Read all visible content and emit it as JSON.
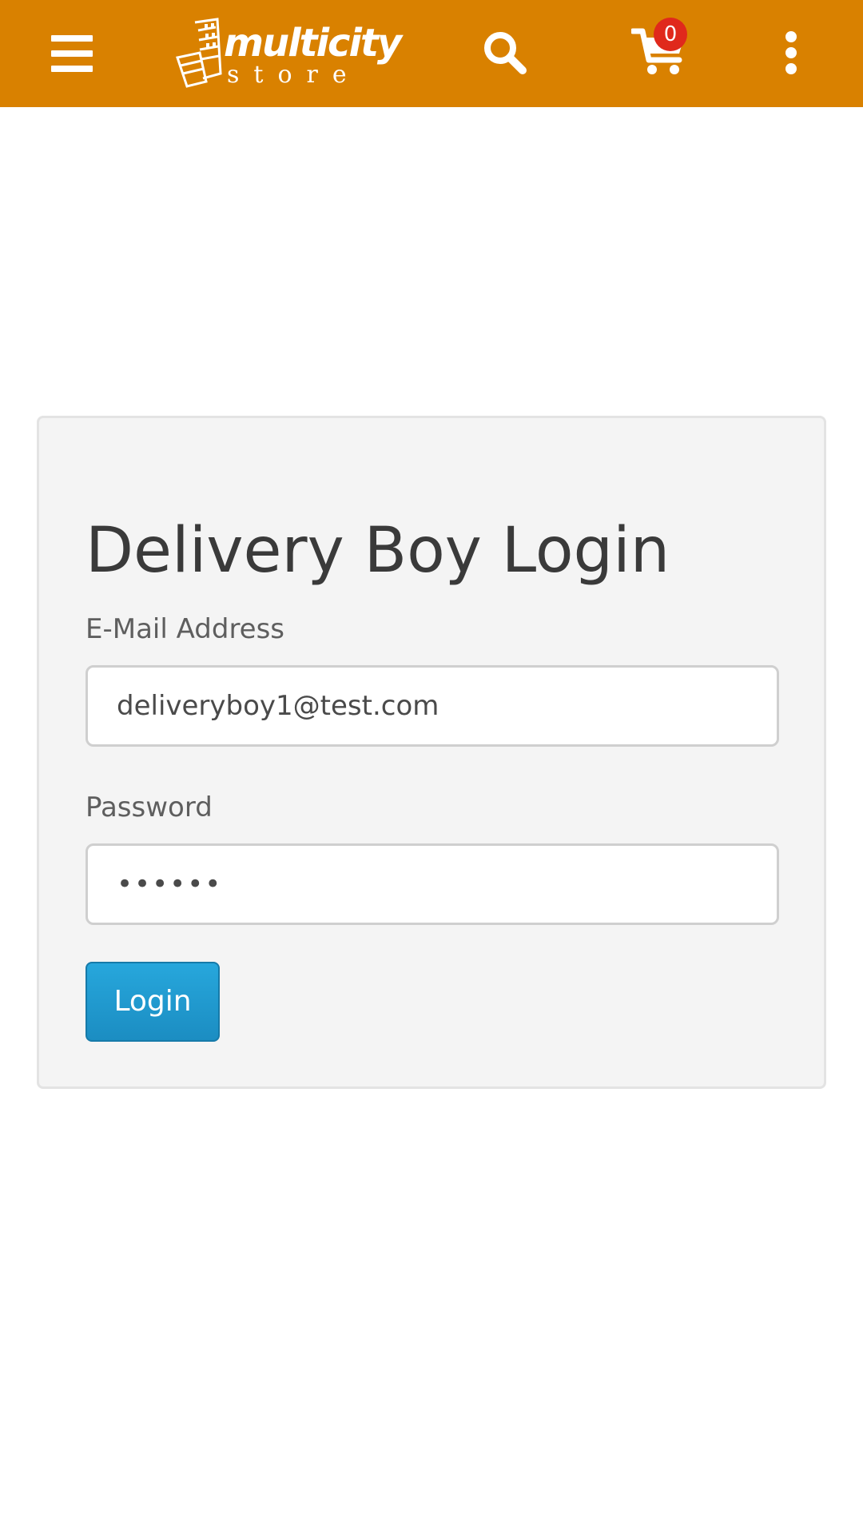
{
  "header": {
    "background_color": "#d98100",
    "logo": {
      "name": "multicity",
      "subtitle": "store"
    },
    "icons": {
      "menu": "hamburger-menu-icon",
      "search": "search-icon",
      "cart": "shopping-cart-icon",
      "more": "vertical-more-icon"
    },
    "cart_count": "0",
    "cart_badge_color": "#e0291c"
  },
  "login_form": {
    "title": "Delivery Boy Login",
    "email_label": "E-Mail Address",
    "email_value": "deliveryboy1@test.com",
    "password_label": "Password",
    "password_value": "••••••",
    "submit_label": "Login",
    "submit_color": "#1f9bd1"
  }
}
